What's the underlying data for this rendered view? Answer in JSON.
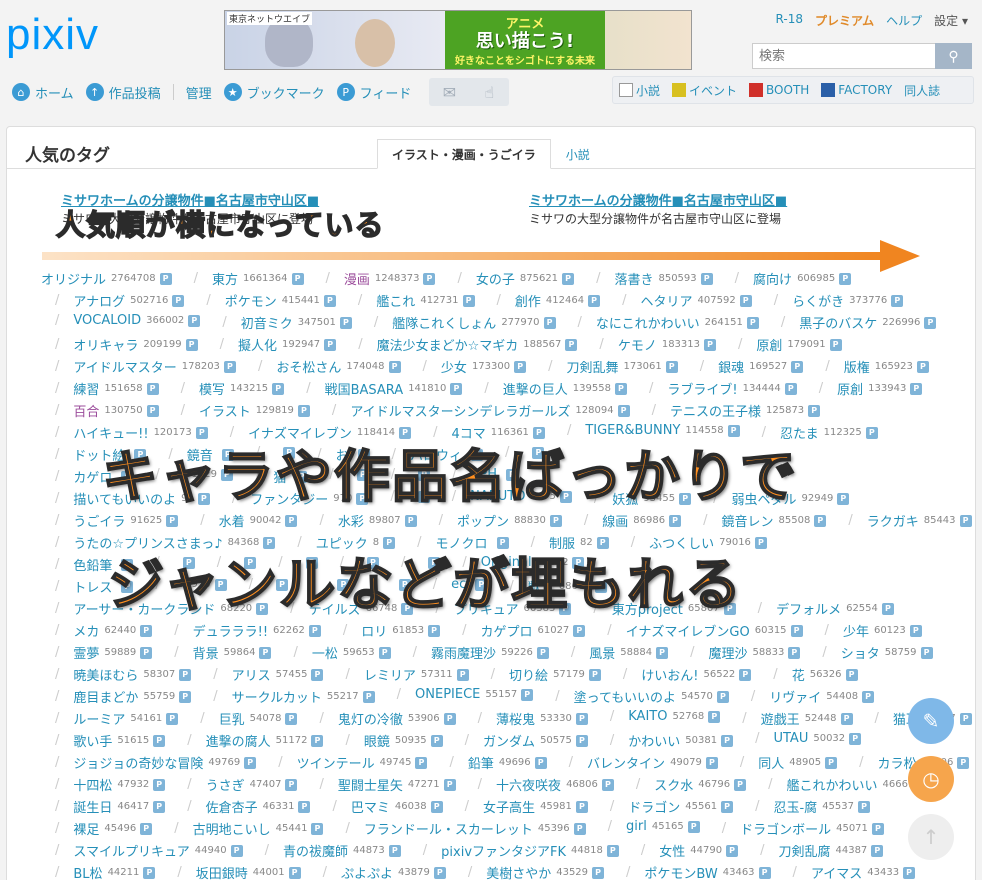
{
  "header": {
    "logo": "pixiv",
    "banner": {
      "tag": "東京ネットウエイブ",
      "line1": "アニメ",
      "line2": "思い描こう!",
      "line3": "好きなことをシゴトにする未来"
    },
    "toplinks": [
      "R-18",
      "プレミアム",
      "ヘルプ",
      "設定 ▾"
    ],
    "search_placeholder": "検索"
  },
  "nav": {
    "items": [
      {
        "label": "ホーム",
        "icon": "home-icon"
      },
      {
        "label": "作品投稿",
        "icon": "upload-icon"
      },
      {
        "label": "管理",
        "icon": ""
      },
      {
        "label": "ブックマーク",
        "icon": "star-icon"
      },
      {
        "label": "フィード",
        "icon": "feed-icon"
      }
    ],
    "right": [
      "小説",
      "イベント",
      "BOOTH",
      "FACTORY",
      "同人誌"
    ]
  },
  "panel": {
    "title": "人気のタグ",
    "tabs": [
      "イラスト・漫画・うごイラ",
      "小説"
    ],
    "ads": [
      {
        "title": "ミサワホームの分譲物件■名古屋市守山区■",
        "desc": "ミサワの大型分譲物件が名古屋市守山区に登場"
      },
      {
        "title": "ミサワホームの分譲物件■名古屋市守山区■",
        "desc": "ミサワの大型分譲物件が名古屋市守山区に登場"
      }
    ]
  },
  "overlay": {
    "small": "人気順が横になっている",
    "big1": "キャラや作品名ばっかりで",
    "big2": "ジャンルなどが埋もれる"
  },
  "tag_rows": [
    [
      [
        "オリジナル",
        "2764708"
      ],
      [
        "東方",
        "1661364"
      ],
      [
        "漫画",
        "1248373"
      ],
      [
        "女の子",
        "875621"
      ],
      [
        "落書き",
        "850593"
      ],
      [
        "腐向け",
        "606985"
      ]
    ],
    [
      [
        "アナログ",
        "502716"
      ],
      [
        "ポケモン",
        "415441"
      ],
      [
        "艦これ",
        "412731"
      ],
      [
        "創作",
        "412464"
      ],
      [
        "ヘタリア",
        "407592"
      ],
      [
        "らくがき",
        "373776"
      ]
    ],
    [
      [
        "VOCALOID",
        "366002"
      ],
      [
        "初音ミク",
        "347501"
      ],
      [
        "艦隊これくしょん",
        "277970"
      ],
      [
        "なにこれかわいい",
        "264151"
      ],
      [
        "黒子のバスケ",
        "226996"
      ]
    ],
    [
      [
        "オリキャラ",
        "209199"
      ],
      [
        "擬人化",
        "192947"
      ],
      [
        "魔法少女まどか☆マギカ",
        "188567"
      ],
      [
        "ケモノ",
        "183313"
      ],
      [
        "原創",
        "179091"
      ]
    ],
    [
      [
        "アイドルマスター",
        "178203"
      ],
      [
        "おそ松さん",
        "174048"
      ],
      [
        "少女",
        "173300"
      ],
      [
        "刀剣乱舞",
        "173061"
      ],
      [
        "銀魂",
        "169527"
      ],
      [
        "版権",
        "165923"
      ]
    ],
    [
      [
        "練習",
        "151658"
      ],
      [
        "模写",
        "143215"
      ],
      [
        "戦国BASARA",
        "141810"
      ],
      [
        "進撃の巨人",
        "139558"
      ],
      [
        "ラブライブ!",
        "134444"
      ],
      [
        "原創",
        "133943"
      ]
    ],
    [
      [
        "百合",
        "130750"
      ],
      [
        "イラスト",
        "129819"
      ],
      [
        "アイドルマスターシンデレラガールズ",
        "128094"
      ],
      [
        "テニスの王子様",
        "125873"
      ]
    ],
    [
      [
        "ハイキュー!!",
        "120173"
      ],
      [
        "イナズマイレブン",
        "118414"
      ],
      [
        "4コマ",
        "116361"
      ],
      [
        "TIGER&BUNNY",
        "114558"
      ],
      [
        "忍たま",
        "112325"
      ]
    ],
    [
      [
        "ドット絵",
        ""
      ],
      [
        "鏡音",
        ""
      ],
      [
        "",
        ""
      ],
      [
        "お",
        ""
      ],
      [
        "ハロウィ",
        ""
      ],
      [
        "",
        ""
      ]
    ],
    [
      [
        "カゲロ",
        ""
      ],
      [
        "",
        "101729"
      ],
      [
        "猫",
        ""
      ],
      [
        "",
        ""
      ],
      [
        "",
        ""
      ],
      [
        "APH",
        ""
      ]
    ],
    [
      [
        "描いてもいいのよ",
        "94"
      ],
      [
        "ファンタジー",
        "970"
      ],
      [
        "",
        ""
      ],
      [
        "NARUTO",
        "9475"
      ],
      [
        "妖狐",
        "93455"
      ],
      [
        "弱虫ペダル",
        "92949"
      ]
    ],
    [
      [
        "うごイラ",
        "91625"
      ],
      [
        "水着",
        "90042"
      ],
      [
        "水彩",
        "89807"
      ],
      [
        "ポップン",
        "88830"
      ],
      [
        "線画",
        "86986"
      ],
      [
        "鏡音レン",
        "85508"
      ],
      [
        "ラクガキ",
        "85443"
      ]
    ],
    [
      [
        "うたの☆プリンスさまっ♪",
        "84368"
      ],
      [
        "ユピック",
        "8"
      ],
      [
        "モノクロ",
        ""
      ],
      [
        "制服",
        "82"
      ],
      [
        "ふつくしい",
        "79016"
      ]
    ],
    [
      [
        "色鉛筆",
        ""
      ],
      [
        "",
        ""
      ],
      [
        "",
        ""
      ],
      [
        "",
        ""
      ],
      [
        "",
        ""
      ],
      [
        "",
        ""
      ],
      [
        "Original",
        "75082"
      ]
    ],
    [
      [
        "トレス",
        ""
      ],
      [
        "",
        "70950"
      ],
      [
        "",
        ""
      ],
      [
        "",
        ""
      ],
      [
        "",
        ""
      ],
      [
        "ec",
        ""
      ],
      [
        "獣人",
        "68662"
      ]
    ],
    [
      [
        "アーサー・カークランド",
        "68220"
      ],
      [
        "テイルズ",
        "66748"
      ],
      [
        "プリキュア",
        "66383"
      ],
      [
        "東方project",
        "65807"
      ],
      [
        "デフォルメ",
        "62554"
      ]
    ],
    [
      [
        "メカ",
        "62440"
      ],
      [
        "デュラララ!!",
        "62262"
      ],
      [
        "ロリ",
        "61853"
      ],
      [
        "カゲプロ",
        "61027"
      ],
      [
        "イナズマイレブンGO",
        "60315"
      ],
      [
        "少年",
        "60123"
      ]
    ],
    [
      [
        "霊夢",
        "59889"
      ],
      [
        "背景",
        "59864"
      ],
      [
        "一松",
        "59653"
      ],
      [
        "霧雨魔理沙",
        "59226"
      ],
      [
        "風景",
        "58884"
      ],
      [
        "魔理沙",
        "58833"
      ],
      [
        "ショタ",
        "58759"
      ]
    ],
    [
      [
        "暁美ほむら",
        "58307"
      ],
      [
        "アリス",
        "57455"
      ],
      [
        "レミリア",
        "57311"
      ],
      [
        "切り絵",
        "57179"
      ],
      [
        "けいおん!",
        "56522"
      ],
      [
        "花",
        "56326"
      ]
    ],
    [
      [
        "鹿目まどか",
        "55759"
      ],
      [
        "サークルカット",
        "55217"
      ],
      [
        "ONEPIECE",
        "55157"
      ],
      [
        "塗ってもいいのよ",
        "54570"
      ],
      [
        "リヴァイ",
        "54408"
      ]
    ],
    [
      [
        "ルーミア",
        "54161"
      ],
      [
        "巨乳",
        "54078"
      ],
      [
        "鬼灯の冷徹",
        "53906"
      ],
      [
        "薄桜鬼",
        "53330"
      ],
      [
        "KAITO",
        "52768"
      ],
      [
        "遊戯王",
        "52448"
      ],
      [
        "猫耳",
        "52097"
      ]
    ],
    [
      [
        "歌い手",
        "51615"
      ],
      [
        "進撃の腐人",
        "51172"
      ],
      [
        "眼鏡",
        "50935"
      ],
      [
        "ガンダム",
        "50575"
      ],
      [
        "かわいい",
        "50381"
      ],
      [
        "UTAU",
        "50032"
      ]
    ],
    [
      [
        "ジョジョの奇妙な冒険",
        "49769"
      ],
      [
        "ツインテール",
        "49745"
      ],
      [
        "鉛筆",
        "49696"
      ],
      [
        "バレンタイン",
        "49079"
      ],
      [
        "同人",
        "48905"
      ],
      [
        "カラ松",
        "48406"
      ]
    ],
    [
      [
        "十四松",
        "47932"
      ],
      [
        "うさぎ",
        "47407"
      ],
      [
        "聖闘士星矢",
        "47271"
      ],
      [
        "十六夜咲夜",
        "46806"
      ],
      [
        "スク水",
        "46796"
      ],
      [
        "艦これかわいい",
        "46661"
      ]
    ],
    [
      [
        "誕生日",
        "46417"
      ],
      [
        "佐倉杏子",
        "46331"
      ],
      [
        "巴マミ",
        "46038"
      ],
      [
        "女子高生",
        "45981"
      ],
      [
        "ドラゴン",
        "45561"
      ],
      [
        "忍玉-腐",
        "45537"
      ]
    ],
    [
      [
        "裸足",
        "45496"
      ],
      [
        "古明地こいし",
        "45441"
      ],
      [
        "フランドール・スカーレット",
        "45396"
      ],
      [
        "girl",
        "45165"
      ],
      [
        "ドラゴンボール",
        "45071"
      ]
    ],
    [
      [
        "スマイルプリキュア",
        "44940"
      ],
      [
        "青の祓魔師",
        "44873"
      ],
      [
        "pixivファンタジアFK",
        "44818"
      ],
      [
        "女性",
        "44790"
      ],
      [
        "刀剣乱腐",
        "44387"
      ]
    ],
    [
      [
        "BL松",
        "44211"
      ],
      [
        "坂田銀時",
        "44001"
      ],
      [
        "ぷよぷよ",
        "43879"
      ],
      [
        "美樹さやか",
        "43529"
      ],
      [
        "ポケモンBW",
        "43463"
      ],
      [
        "アイマス",
        "43433"
      ]
    ]
  ]
}
